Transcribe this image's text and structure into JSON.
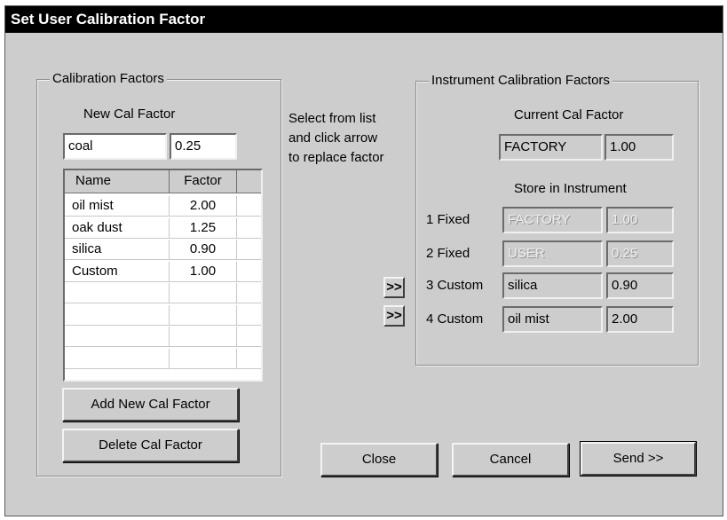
{
  "window": {
    "title": "Set User Calibration Factor"
  },
  "calibration": {
    "legend": "Calibration Factors",
    "new_cal_label": "New Cal Factor",
    "name_value": "coal",
    "factor_value": "0.25",
    "columns": [
      "Name",
      "Factor"
    ],
    "rows": [
      {
        "name": "oil mist",
        "factor": "2.00"
      },
      {
        "name": "oak dust",
        "factor": "1.25"
      },
      {
        "name": "silica",
        "factor": "0.90"
      },
      {
        "name": "Custom",
        "factor": "1.00"
      },
      {
        "name": "",
        "factor": ""
      },
      {
        "name": "",
        "factor": ""
      },
      {
        "name": "",
        "factor": ""
      },
      {
        "name": "",
        "factor": ""
      }
    ],
    "add_button": "Add New Cal Factor",
    "delete_button": "Delete Cal Factor"
  },
  "instructions": [
    "Select from list",
    "and click arrow",
    "to replace factor"
  ],
  "arrow_label": ">>",
  "instrument": {
    "legend": "Instrument Calibration Factors",
    "current_label": "Current Cal Factor",
    "current_name": "FACTORY",
    "current_value": "1.00",
    "store_label": "Store in Instrument",
    "slots": [
      {
        "label": "1 Fixed",
        "name": "FACTORY",
        "value": "1.00",
        "disabled": true
      },
      {
        "label": "2 Fixed",
        "name": "USER",
        "value": "0.25",
        "disabled": true
      },
      {
        "label": "3 Custom",
        "name": "silica",
        "value": "0.90",
        "disabled": false
      },
      {
        "label": "4 Custom",
        "name": "oil mist",
        "value": "2.00",
        "disabled": false
      }
    ]
  },
  "buttons": {
    "close": "Close",
    "cancel": "Cancel",
    "send": "Send >>"
  }
}
